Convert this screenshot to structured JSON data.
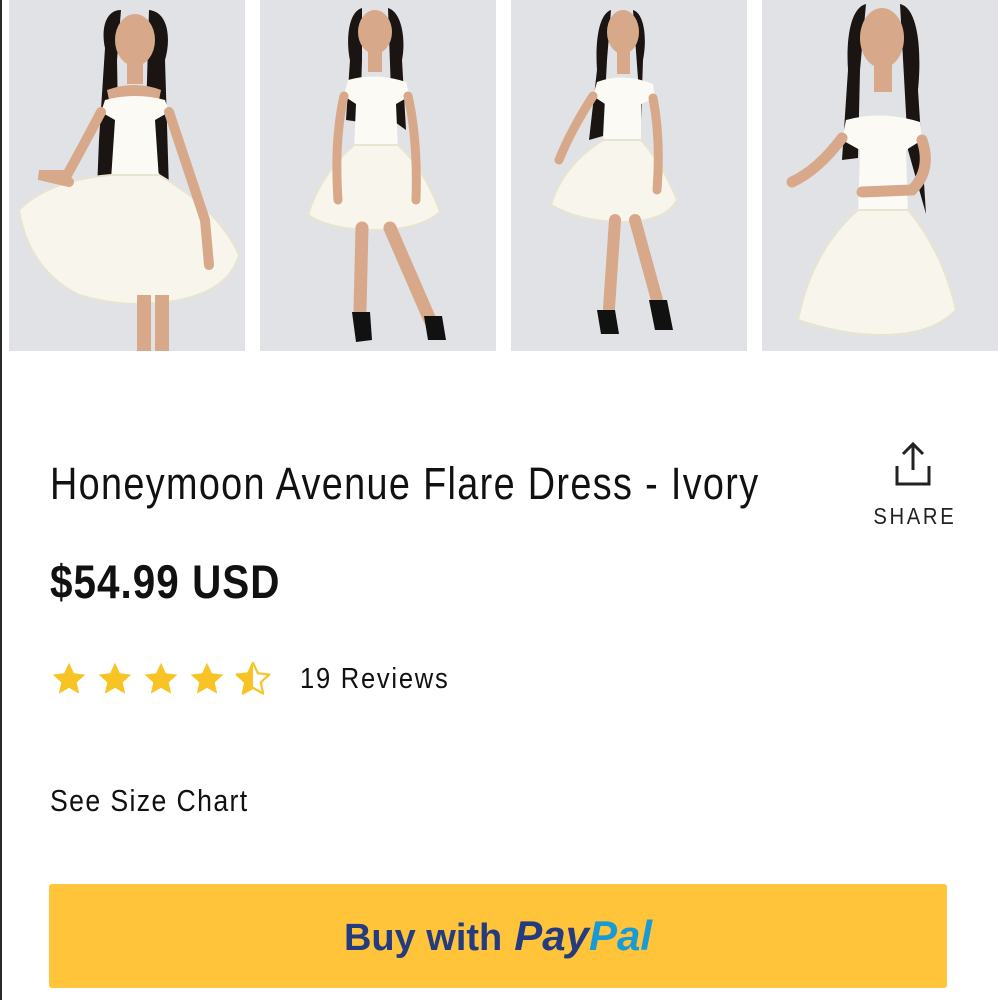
{
  "gallery": {
    "images": [
      {
        "name": "product-photo-1",
        "pose": "holding-skirt"
      },
      {
        "name": "product-photo-2",
        "pose": "front"
      },
      {
        "name": "product-photo-3",
        "pose": "side"
      },
      {
        "name": "product-photo-4",
        "pose": "close-up"
      }
    ]
  },
  "product": {
    "title": "Honeymoon Avenue Flare Dress - Ivory",
    "price": "$54.99 USD",
    "rating": 4.5,
    "reviews_label": "19 Reviews"
  },
  "share": {
    "label": "SHARE",
    "icon": "share-icon"
  },
  "size_chart": {
    "label": "See Size Chart"
  },
  "paypal": {
    "prefix": "Buy with",
    "brand_pay": "Pay",
    "brand_pal": "Pal",
    "button_color": "#ffc439",
    "brand_dark": "#253b80",
    "brand_light": "#179bd7"
  },
  "colors": {
    "star": "#f7c325",
    "text": "#111111",
    "photo_bg": "#e1e2e6"
  }
}
